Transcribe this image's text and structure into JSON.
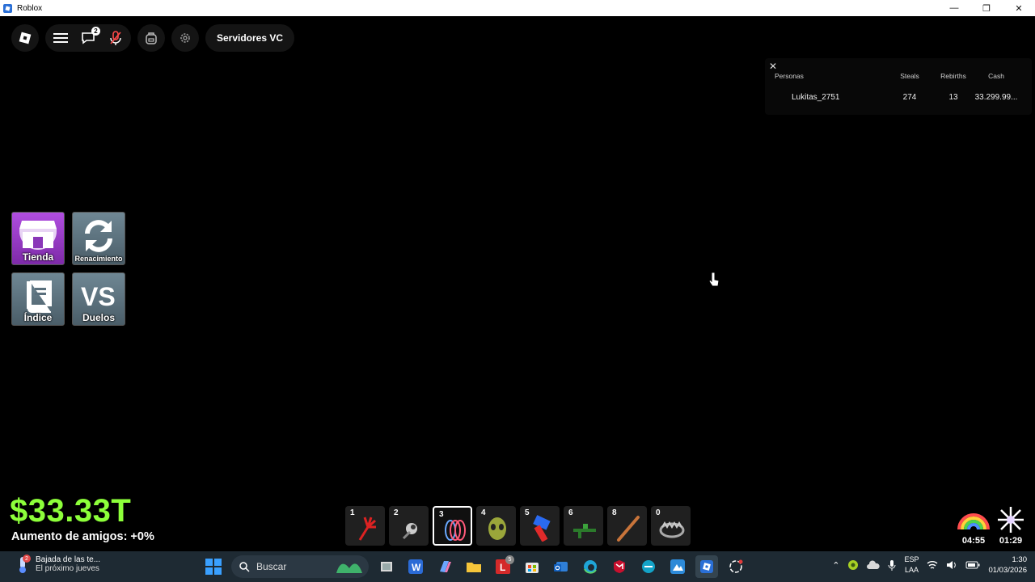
{
  "window": {
    "title": "Roblox",
    "controls": {
      "minimize": "—",
      "maximize": "❐",
      "close": "✕"
    }
  },
  "topbar": {
    "chat_badge": "2",
    "servers_label": "Servidores VC"
  },
  "leaderboard": {
    "close": "✕",
    "headers": {
      "name": "Personas",
      "steals": "Steals",
      "rebirths": "Rebirths",
      "cash": "Cash"
    },
    "rows": [
      {
        "name": "Lukitas_2751",
        "steals": "274",
        "rebirths": "13",
        "cash": "33.299.99..."
      }
    ]
  },
  "side_buttons": {
    "shop": "Tienda",
    "rebirth": "Renacimiento",
    "index": "Índice",
    "duels": "Duelos"
  },
  "money": {
    "amount": "$33.33T",
    "friends_boost": "Aumento de amigos: +0%"
  },
  "hotbar": {
    "slots": [
      {
        "num": "1",
        "icon": "red-claw-icon"
      },
      {
        "num": "2",
        "icon": "grapple-icon"
      },
      {
        "num": "3",
        "icon": "coil-spring-icon",
        "selected": true
      },
      {
        "num": "4",
        "icon": "alien-mask-icon"
      },
      {
        "num": "5",
        "icon": "red-blue-hammer-icon"
      },
      {
        "num": "6",
        "icon": "green-gun-icon"
      },
      {
        "num": "8",
        "icon": "bat-icon"
      },
      {
        "num": "0",
        "icon": "bear-trap-icon"
      }
    ]
  },
  "timers": {
    "rainbow": "04:55",
    "sparkle": "01:29"
  },
  "taskbar": {
    "weather_title": "Bajada de las te...",
    "weather_sub": "El próximo jueves",
    "weather_badge": "2",
    "search_placeholder": "Buscar",
    "mail_badge": "5",
    "lang_top": "ESP",
    "lang_bottom": "LAA",
    "time": "1:30",
    "date": "01/03/2026"
  },
  "colors": {
    "money_green": "#8dff3a",
    "taskbar_bg": "#1e2a33",
    "shop_purple": "#9b3fd0",
    "slate_button": "#5a6f7c"
  }
}
